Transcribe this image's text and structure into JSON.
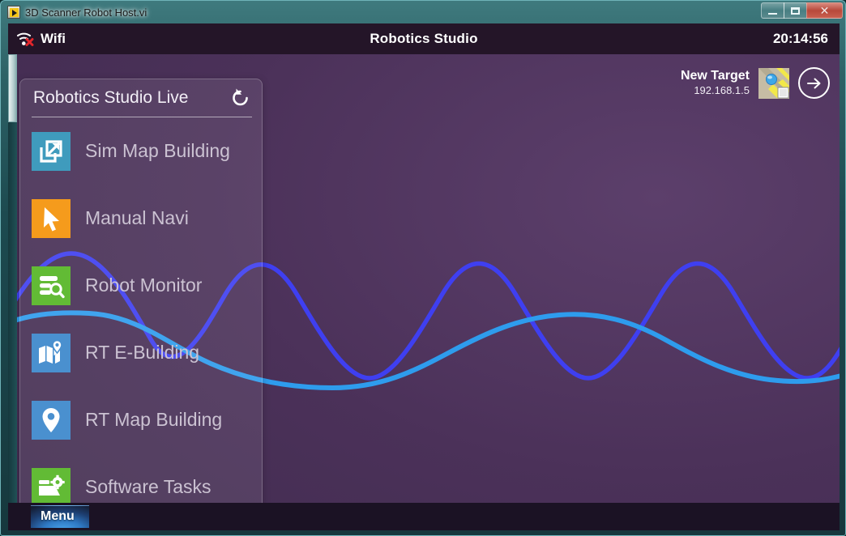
{
  "window": {
    "title": "3D Scanner Robot Host.vi",
    "icon": "labview-vi-icon",
    "controls": {
      "minimize": "minimize-button",
      "maximize": "maximize-button",
      "close": "close-button",
      "close_glyph": "✕"
    }
  },
  "statusbar": {
    "wifi_icon": "wifi-disconnected-icon",
    "wifi_label": "Wifi",
    "app_title": "Robotics Studio",
    "clock": "20:14:56"
  },
  "header": {
    "target_title": "New Target",
    "target_ip": "192.168.1.5",
    "thumbnail_icon": "map-target-thumbnail-icon",
    "go_icon": "arrow-right-circle-icon"
  },
  "panel": {
    "title": "Robotics Studio Live",
    "refresh_icon": "refresh-counterclockwise-icon",
    "items": [
      {
        "label": "Sim Map Building",
        "icon": "external-link-icon",
        "color": "#3f9bbd"
      },
      {
        "label": "Manual Navi",
        "icon": "cursor-arrow-icon",
        "color": "#f59b1c"
      },
      {
        "label": "Robot Monitor",
        "icon": "list-search-icon",
        "color": "#62bb35"
      },
      {
        "label": "RT E-Building",
        "icon": "map-pin-folded-icon",
        "color": "#4a90cf"
      },
      {
        "label": "RT Map Building",
        "icon": "location-pin-icon",
        "color": "#4a90cf"
      },
      {
        "label": "Software Tasks",
        "icon": "folder-gear-icon",
        "color": "#62bb35"
      }
    ]
  },
  "bottombar": {
    "menu_label": "Menu"
  },
  "colors": {
    "canvas_purple": "#4b3159",
    "statusbar": "#241528",
    "wave_indigo": "#3f3ff0",
    "wave_cyan": "#2e9ced",
    "frame_teal": "#1d4a50"
  },
  "waves": {
    "series": [
      {
        "name": "indigo-wave",
        "color": "#3f3ff0",
        "amplitude": 58,
        "wavelength": 300,
        "baseline": 310
      },
      {
        "name": "cyan-wave",
        "color": "#2e9ced",
        "amplitude": 32,
        "wavelength": 470,
        "baseline": 318
      }
    ]
  }
}
